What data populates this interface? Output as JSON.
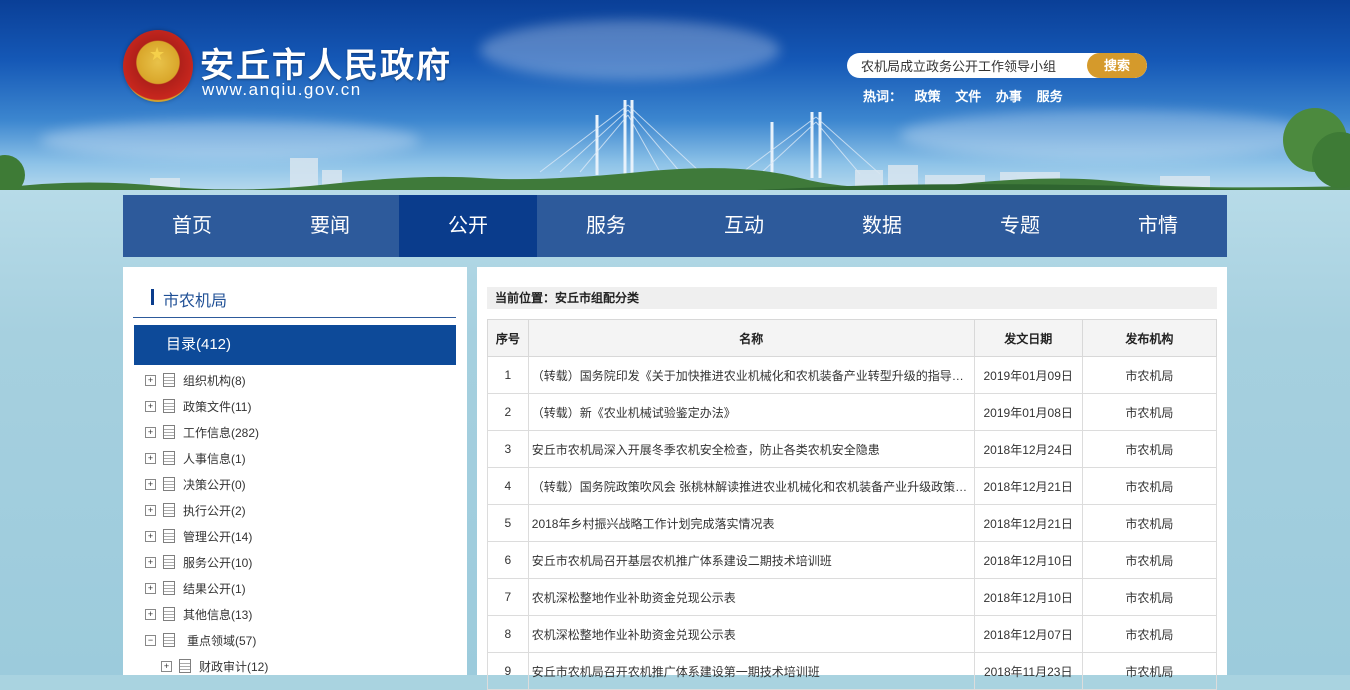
{
  "header": {
    "site_title": "安丘市人民政府",
    "site_url": "www.anqiu.gov.cn",
    "search": {
      "value": "农机局成立政务公开工作领导小组",
      "button": "搜索"
    },
    "hot": {
      "label": "热词：",
      "keywords": [
        "政策",
        "文件",
        "办事",
        "服务"
      ]
    }
  },
  "nav": [
    "首页",
    "要闻",
    "公开",
    "服务",
    "互动",
    "数据",
    "专题",
    "市情"
  ],
  "sidebar": {
    "title": "市农机局",
    "catalog": "目录(412)",
    "items": [
      "组织机构(8)",
      "政策文件(11)",
      "工作信息(282)",
      "人事信息(1)",
      "决策公开(0)",
      "执行公开(2)",
      "管理公开(14)",
      "服务公开(10)",
      "结果公开(1)",
      "其他信息(13)",
      "重点领域(57)"
    ],
    "child_items": [
      "财政审计(12)"
    ]
  },
  "main": {
    "breadcrumb": "当前位置：安丘市组配分类",
    "columns": [
      "序号",
      "名称",
      "发文日期",
      "发布机构"
    ],
    "rows": [
      {
        "no": "1",
        "title": "（转载）国务院印发《关于加快推进农业机械化和农机装备产业转型升级的指导意见》",
        "date": "2019年01月09日",
        "org": "市农机局"
      },
      {
        "no": "2",
        "title": "（转载）新《农业机械试验鉴定办法》",
        "date": "2019年01月08日",
        "org": "市农机局"
      },
      {
        "no": "3",
        "title": "安丘市农机局深入开展冬季农机安全检查，防止各类农机安全隐患",
        "date": "2018年12月24日",
        "org": "市农机局"
      },
      {
        "no": "4",
        "title": "（转载）国务院政策吹风会 张桃林解读推进农业机械化和农机装备产业升级政策措施",
        "date": "2018年12月21日",
        "org": "市农机局"
      },
      {
        "no": "5",
        "title": "2018年乡村振兴战略工作计划完成落实情况表",
        "date": "2018年12月21日",
        "org": "市农机局"
      },
      {
        "no": "6",
        "title": "安丘市农机局召开基层农机推广体系建设二期技术培训班",
        "date": "2018年12月10日",
        "org": "市农机局"
      },
      {
        "no": "7",
        "title": "农机深松整地作业补助资金兑现公示表",
        "date": "2018年12月10日",
        "org": "市农机局"
      },
      {
        "no": "8",
        "title": "农机深松整地作业补助资金兑现公示表",
        "date": "2018年12月07日",
        "org": "市农机局"
      },
      {
        "no": "9",
        "title": "安丘市农机局召开农机推广体系建设第一期技术培训班",
        "date": "2018年11月23日",
        "org": "市农机局"
      }
    ]
  }
}
